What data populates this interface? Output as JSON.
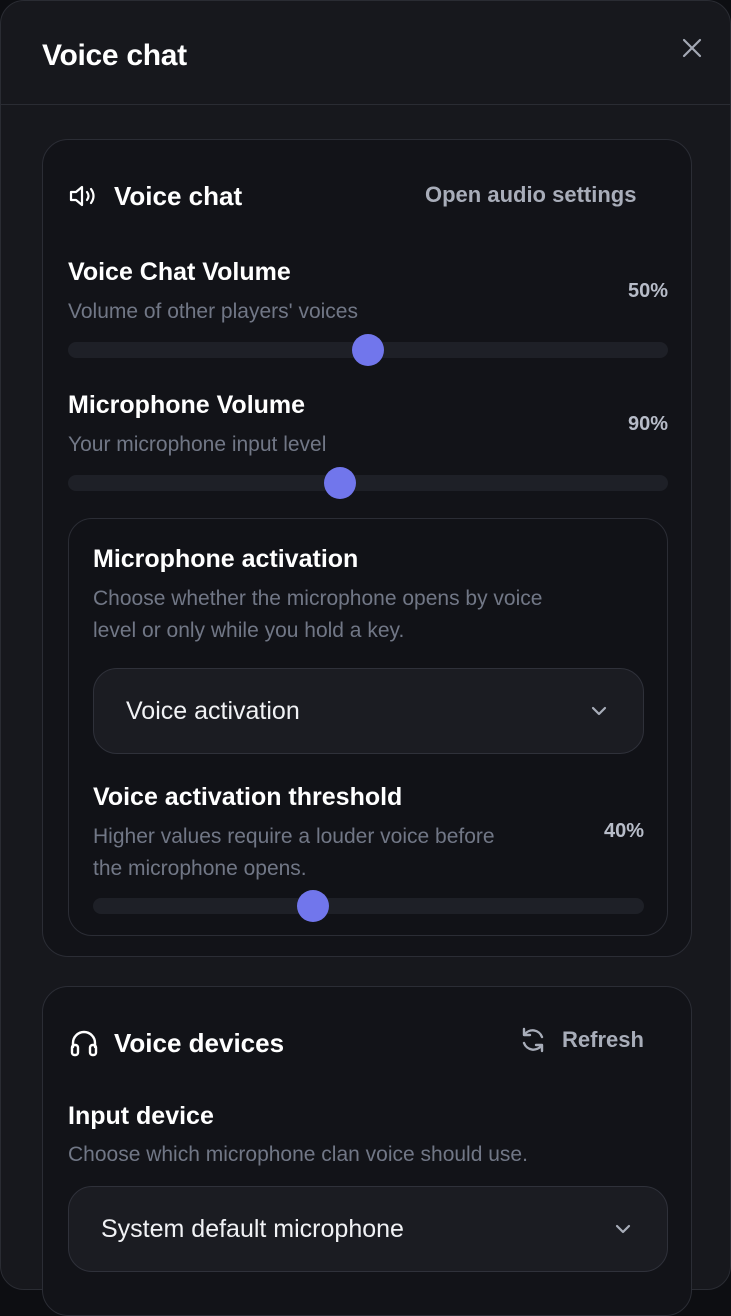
{
  "dialog": {
    "title": "Voice chat",
    "close_icon": "close-icon"
  },
  "voice_chat": {
    "heading": "Voice chat",
    "icon": "speaker-icon",
    "open_settings_label": "Open audio settings",
    "chat_volume": {
      "title": "Voice Chat Volume",
      "description": "Volume of other players' voices",
      "value_text": "50%",
      "value": 0.5
    },
    "mic_volume": {
      "title": "Microphone Volume",
      "description": "Your microphone input level",
      "value_text": "90%",
      "value": 0.9
    },
    "activation": {
      "title": "Microphone activation",
      "description_line1": "Choose whether the microphone opens by voice",
      "description_line2": "level or only while you hold a key.",
      "selected": "Voice activation"
    },
    "threshold": {
      "title": "Voice activation threshold",
      "description_line1": "Higher values require a louder voice before",
      "description_line2": "the microphone opens.",
      "value_text": "40%",
      "value": 0.4
    }
  },
  "voice_devices": {
    "heading": "Voice devices",
    "icon": "headphones-icon",
    "refresh_label": "Refresh",
    "refresh_icon": "refresh-icon",
    "input_device": {
      "title": "Input device",
      "description": "Choose which microphone clan voice should use.",
      "selected": "System default microphone"
    }
  },
  "colors": {
    "accent": "#7176ec",
    "background": "#17181d",
    "card": "#121318",
    "muted_text": "#717786"
  }
}
